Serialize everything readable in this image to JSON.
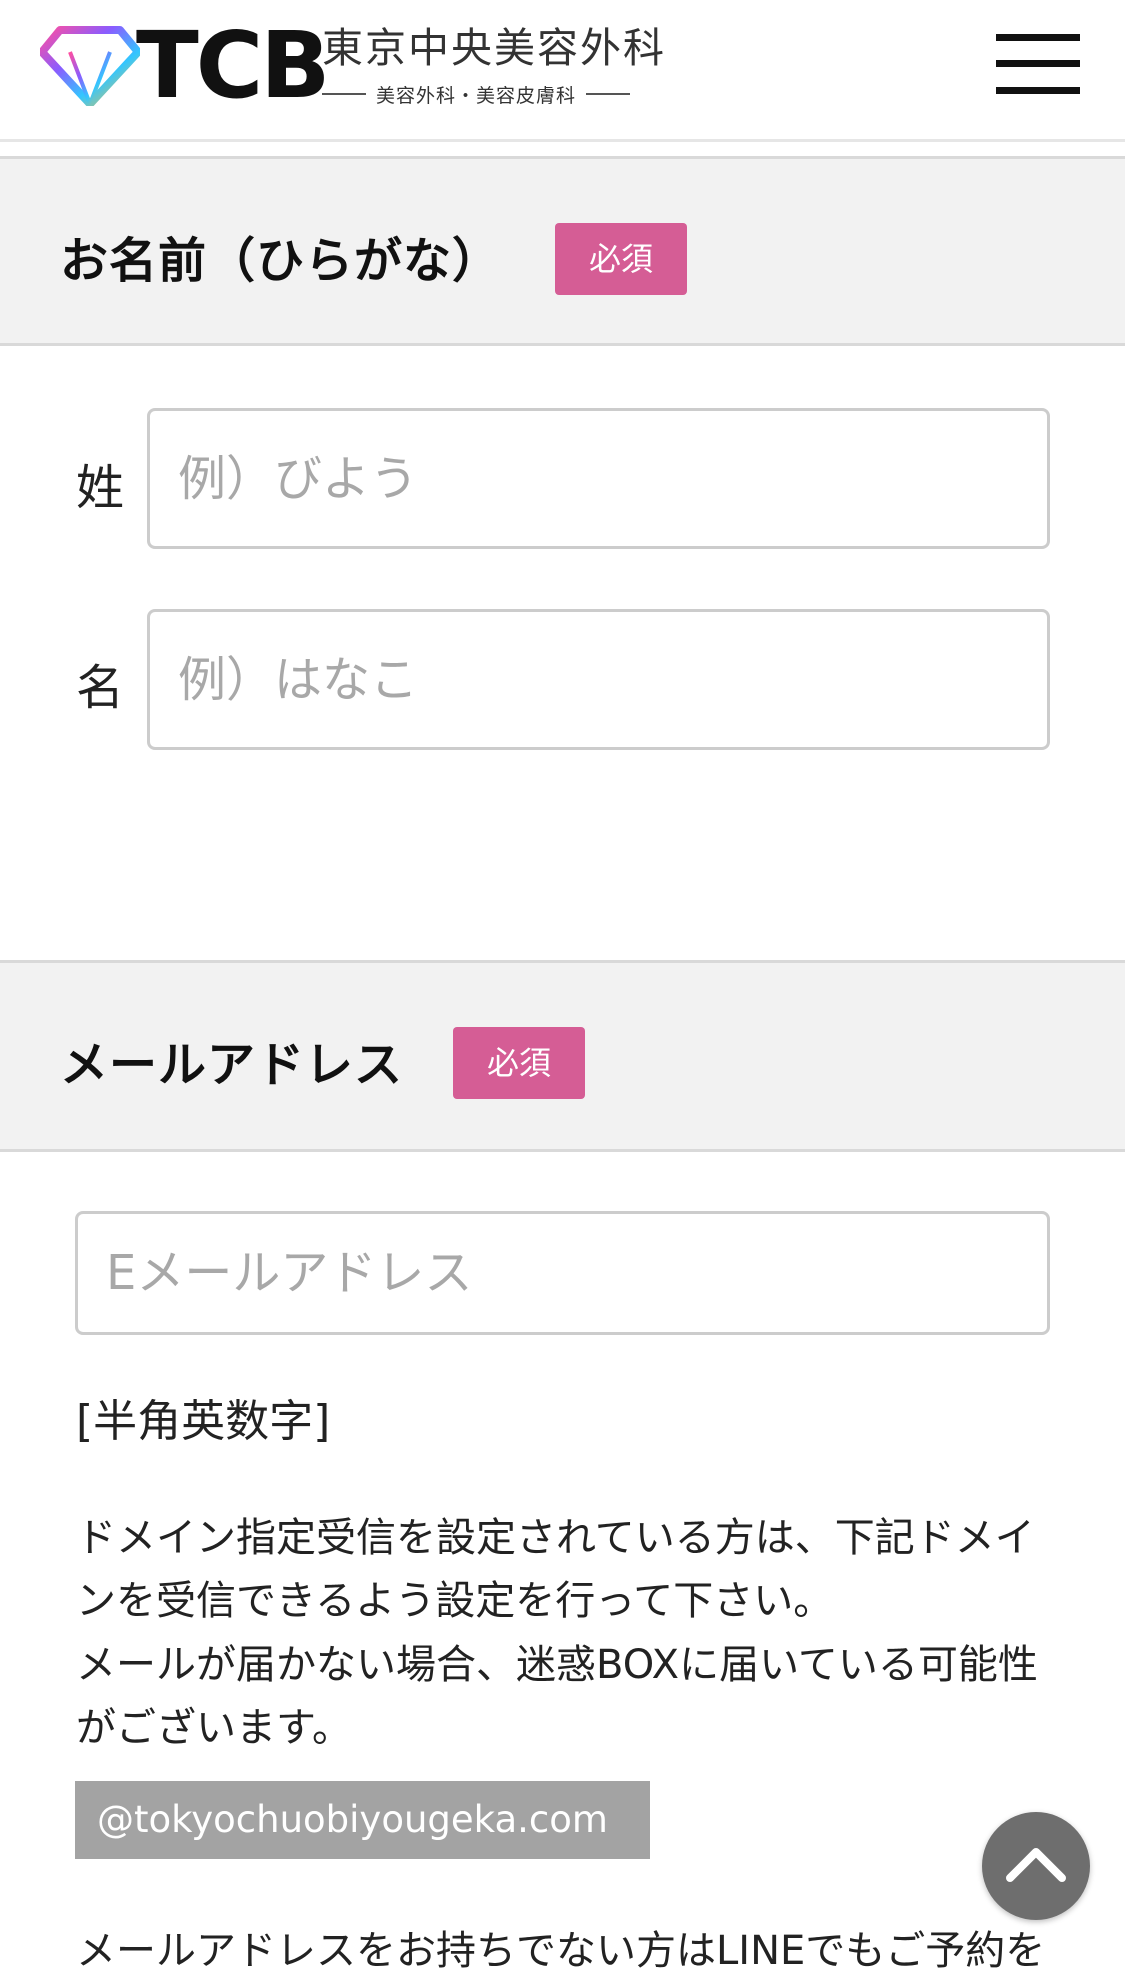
{
  "header": {
    "logo_text": "TCB",
    "clinic_name": "東京中央美容外科",
    "clinic_sub": "美容外科・美容皮膚科",
    "menu_icon": "hamburger-menu-icon"
  },
  "name_section": {
    "title": "お名前（ひらがな）",
    "required_label": "必須",
    "last_name_label": "姓",
    "last_name_placeholder": "例）びよう",
    "last_name_value": "",
    "first_name_label": "名",
    "first_name_placeholder": "例）はなこ",
    "first_name_value": ""
  },
  "email_section": {
    "title": "メールアドレス",
    "required_label": "必須",
    "email_placeholder": "Eメールアドレス",
    "email_value": "",
    "format_note": "[半角英数字]",
    "domain_note_1": "ドメイン指定受信を設定されている方は、下記ドメインを受信できるよう設定を行って下さい。",
    "domain_note_2": "メールが届かない場合、迷惑BOXに届いている可能性がございます。",
    "domain": "@tokyochuobiyougeka.com",
    "line_note": "メールアドレスをお持ちでない方はLINEでもご予約を"
  },
  "scroll_top": {
    "icon": "chevron-up-icon"
  },
  "colors": {
    "badge": "#d55d95",
    "section_bg": "#f2f2f2",
    "domain_bg": "#a3a3a3",
    "scroll_btn": "#6e6e6e"
  }
}
